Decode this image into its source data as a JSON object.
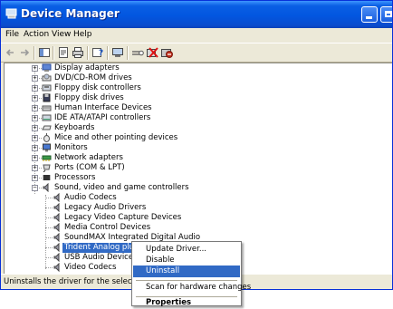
{
  "window": {
    "title": "Device Manager"
  },
  "menubar": {
    "items": [
      "File",
      "Action",
      "View",
      "Help"
    ]
  },
  "toolbar": {
    "icons": [
      "back-arrow-icon",
      "forward-arrow-icon",
      "console-tree-icon",
      "properties-icon",
      "print-icon",
      "help-icon",
      "update-driver-icon",
      "scan-hardware-icon",
      "uninstall-icon",
      "disable-icon"
    ]
  },
  "tree": {
    "categories": [
      "Display adapters",
      "DVD/CD-ROM drives",
      "Floppy disk controllers",
      "Floppy disk drives",
      "Human Interface Devices",
      "IDE ATA/ATAPI controllers",
      "Keyboards",
      "Mice and other pointing devices",
      "Monitors",
      "Network adapters",
      "Ports (COM & LPT)",
      "Processors",
      "Sound, video and game controllers"
    ],
    "sound_children": [
      "Audio Codecs",
      "Legacy Audio Drivers",
      "Legacy Video Capture Devices",
      "Media Control Devices",
      "SoundMAX Integrated Digital Audio",
      "Trident Analog plus Dig",
      "USB Audio Device",
      "Video Codecs"
    ],
    "selected_index": 5
  },
  "context_menu": {
    "items": [
      "Update Driver...",
      "Disable",
      "Uninstall",
      "Scan for hardware changes",
      "Properties"
    ],
    "highlighted": "Uninstall"
  },
  "status": {
    "text": "Uninstalls the driver for the selected de"
  }
}
